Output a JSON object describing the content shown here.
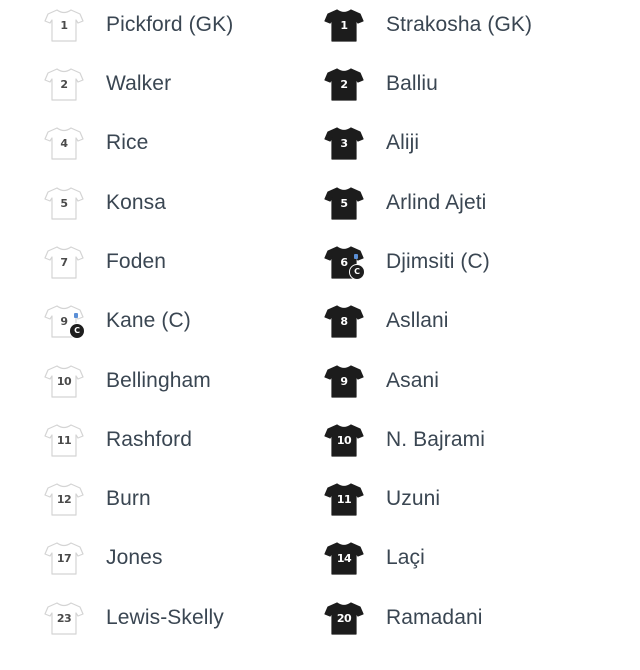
{
  "colors": {
    "home_shirt": "#ffffff",
    "home_shirt_outline": "#d4d4d4",
    "away_shirt": "#1c1c1c",
    "name_text": "#3a4652",
    "captain_badge": "#1e1e1e"
  },
  "home": {
    "shirt_icon": "white-shirt-icon",
    "players": [
      {
        "number": "1",
        "name": "Pickford (GK)",
        "captain": false
      },
      {
        "number": "2",
        "name": "Walker",
        "captain": false
      },
      {
        "number": "4",
        "name": "Rice",
        "captain": false
      },
      {
        "number": "5",
        "name": "Konsa",
        "captain": false
      },
      {
        "number": "7",
        "name": "Foden",
        "captain": false
      },
      {
        "number": "9",
        "name": "Kane (C)",
        "captain": true,
        "badge": "C"
      },
      {
        "number": "10",
        "name": "Bellingham",
        "captain": false
      },
      {
        "number": "11",
        "name": "Rashford",
        "captain": false
      },
      {
        "number": "12",
        "name": "Burn",
        "captain": false
      },
      {
        "number": "17",
        "name": "Jones",
        "captain": false
      },
      {
        "number": "23",
        "name": "Lewis-Skelly",
        "captain": false
      }
    ]
  },
  "away": {
    "shirt_icon": "black-shirt-icon",
    "players": [
      {
        "number": "1",
        "name": "Strakosha (GK)",
        "captain": false
      },
      {
        "number": "2",
        "name": "Balliu",
        "captain": false
      },
      {
        "number": "3",
        "name": "Aliji",
        "captain": false
      },
      {
        "number": "5",
        "name": "Arlind Ajeti",
        "captain": false
      },
      {
        "number": "6",
        "name": "Djimsiti (C)",
        "captain": true,
        "badge": "C"
      },
      {
        "number": "8",
        "name": "Asllani",
        "captain": false
      },
      {
        "number": "9",
        "name": "Asani",
        "captain": false
      },
      {
        "number": "10",
        "name": "N. Bajrami",
        "captain": false
      },
      {
        "number": "11",
        "name": "Uzuni",
        "captain": false
      },
      {
        "number": "14",
        "name": "Laçi",
        "captain": false
      },
      {
        "number": "20",
        "name": "Ramadani",
        "captain": false
      }
    ]
  }
}
